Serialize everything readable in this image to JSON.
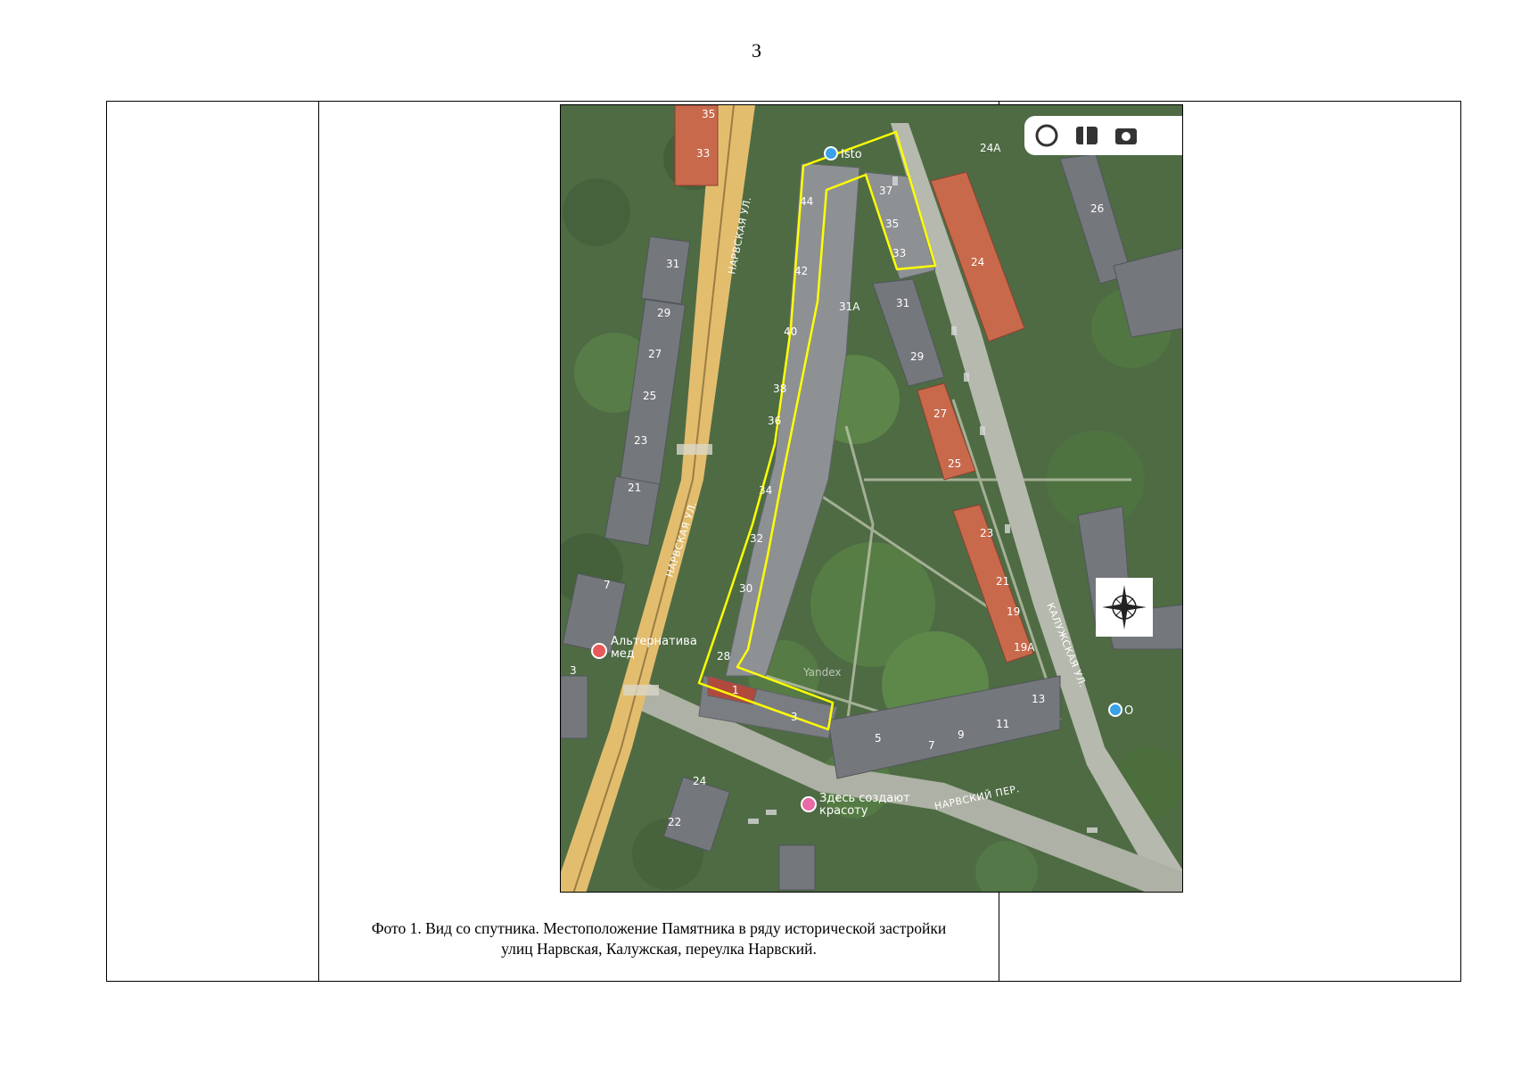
{
  "page_number": "3",
  "map": {
    "building_numbers": {
      "b35_left": "35",
      "b33_left": "33",
      "b31_left": "31",
      "b29_left": "29",
      "b27_left": "27",
      "b25_left": "25",
      "b23_left": "23",
      "b21_left": "21",
      "b7_left": "7",
      "b3_left": "3",
      "b24_bottom": "24",
      "b22_bottom": "22",
      "b44": "44",
      "b42": "42",
      "b40": "40",
      "b38": "38",
      "b36": "36",
      "b34": "34",
      "b32": "32",
      "b30": "30",
      "b28": "28",
      "b1": "1",
      "b3_mid": "3",
      "b37": "37",
      "b35_mid": "35",
      "b33_mid": "33",
      "b31a": "31А",
      "b31_right": "31",
      "b29_right": "29",
      "b27_right": "27",
      "b25_right": "25",
      "b23_right": "23",
      "b21_right": "21",
      "b19": "19",
      "b19a": "19А",
      "b13": "13",
      "b11": "11",
      "b9": "9",
      "b7_bottom": "7",
      "b5": "5",
      "b24_right": "24",
      "b24a": "24А",
      "b26": "26"
    },
    "streets": {
      "narvskaya_top": "НАРВСКАЯ УЛ.",
      "narvskaya_bottom": "НАРВСКАЯ УЛ.",
      "kaluzhskaya": "КАЛУЖСКАЯ УЛ.",
      "narvsky_per": "НАРВСКИЙ ПЕР."
    },
    "poi": {
      "isto": "Isto",
      "alt_line1": "Альтернатива",
      "alt_line2": "мед",
      "beauty_line1": "Здесь создают",
      "beauty_line2": "красоту",
      "shop_o": "О",
      "yandex": "Yandex"
    },
    "icons": [
      "alice-icon",
      "map-book-icon",
      "camera-icon",
      "compass-rose-icon"
    ],
    "colors": {
      "outline": "#ffff00",
      "road": "#e3bd6e",
      "roof_red": "#c8694c",
      "roof_grey": "#74787c"
    }
  },
  "caption": {
    "line1": "Фото 1. Вид со спутника. Местоположение Памятника в ряду исторической застройки",
    "line2": "улиц Нарвская, Калужская, переулка Нарвский."
  }
}
